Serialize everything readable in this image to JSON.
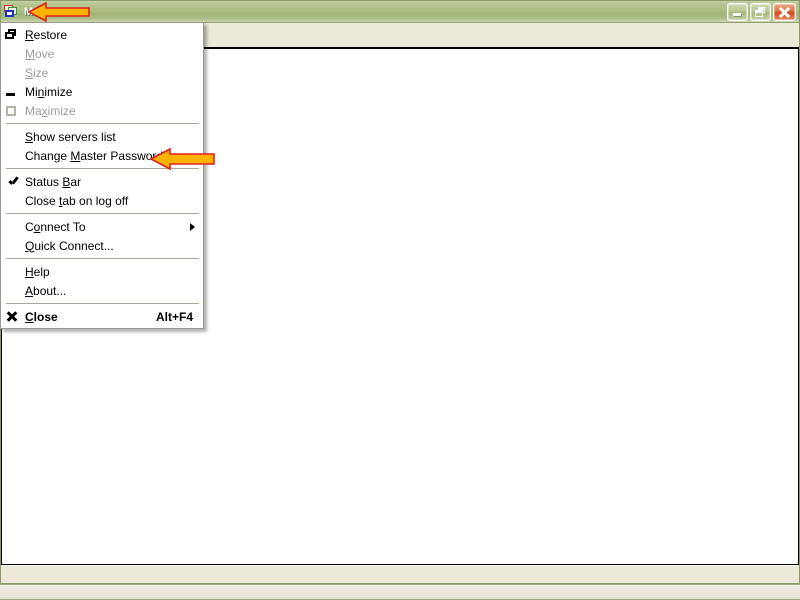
{
  "window": {
    "title": "M...k",
    "icon": "tabs-windows-icon",
    "caption_buttons": [
      {
        "name": "minimize-button",
        "label": "Minimize"
      },
      {
        "name": "restore-button",
        "label": "Restore"
      },
      {
        "name": "close-button",
        "label": "Close"
      }
    ]
  },
  "status_bar": {
    "text": ""
  },
  "system_menu": {
    "items": [
      {
        "type": "item",
        "name": "menu-item-restore",
        "icon": "restore-icon",
        "label": "Restore",
        "mnemonic": "R",
        "accel": "",
        "disabled": false,
        "bold": false,
        "submenu": false
      },
      {
        "type": "item",
        "name": "menu-item-move",
        "icon": "",
        "label": "Move",
        "mnemonic": "M",
        "accel": "",
        "disabled": true,
        "bold": false,
        "submenu": false
      },
      {
        "type": "item",
        "name": "menu-item-size",
        "icon": "",
        "label": "Size",
        "mnemonic": "S",
        "accel": "",
        "disabled": true,
        "bold": false,
        "submenu": false
      },
      {
        "type": "item",
        "name": "menu-item-minimize",
        "icon": "minimize-icon",
        "label": "Minimize",
        "mnemonic": "n",
        "accel": "",
        "disabled": false,
        "bold": false,
        "submenu": false
      },
      {
        "type": "item",
        "name": "menu-item-maximize",
        "icon": "maximize-icon",
        "label": "Maximize",
        "mnemonic": "x",
        "accel": "",
        "disabled": true,
        "bold": false,
        "submenu": false
      },
      {
        "type": "sep",
        "name": "menu-separator-1"
      },
      {
        "type": "item",
        "name": "menu-item-show-servers-list",
        "icon": "",
        "label": "Show servers list",
        "mnemonic": "S",
        "accel": "",
        "disabled": false,
        "bold": false,
        "submenu": false
      },
      {
        "type": "item",
        "name": "menu-item-change-master-password",
        "icon": "",
        "label": "Change Master Password",
        "mnemonic": "M",
        "accel": "",
        "disabled": false,
        "bold": false,
        "submenu": false
      },
      {
        "type": "sep",
        "name": "menu-separator-2"
      },
      {
        "type": "item",
        "name": "menu-item-status-bar",
        "icon": "check-icon",
        "label": "Status Bar",
        "mnemonic": "B",
        "accel": "",
        "disabled": false,
        "bold": false,
        "submenu": false
      },
      {
        "type": "item",
        "name": "menu-item-close-tab-on-logoff",
        "icon": "",
        "label": "Close tab on log off",
        "mnemonic": "t",
        "accel": "",
        "disabled": false,
        "bold": false,
        "submenu": false
      },
      {
        "type": "sep",
        "name": "menu-separator-3"
      },
      {
        "type": "item",
        "name": "menu-item-connect-to",
        "icon": "",
        "label": "Connect To",
        "mnemonic": "o",
        "accel": "",
        "disabled": false,
        "bold": false,
        "submenu": true
      },
      {
        "type": "item",
        "name": "menu-item-quick-connect",
        "icon": "",
        "label": "Quick Connect...",
        "mnemonic": "Q",
        "accel": "",
        "disabled": false,
        "bold": false,
        "submenu": false
      },
      {
        "type": "sep",
        "name": "menu-separator-4"
      },
      {
        "type": "item",
        "name": "menu-item-help",
        "icon": "",
        "label": "Help",
        "mnemonic": "H",
        "accel": "",
        "disabled": false,
        "bold": false,
        "submenu": false
      },
      {
        "type": "item",
        "name": "menu-item-about",
        "icon": "",
        "label": "About...",
        "mnemonic": "A",
        "accel": "",
        "disabled": false,
        "bold": false,
        "submenu": false
      },
      {
        "type": "sep",
        "name": "menu-separator-5"
      },
      {
        "type": "item",
        "name": "menu-item-close",
        "icon": "close-x-icon",
        "label": "Close",
        "mnemonic": "C",
        "accel": "Alt+F4",
        "disabled": false,
        "bold": true,
        "submenu": false
      }
    ]
  },
  "annotations": [
    {
      "name": "annotation-arrow-titlebar",
      "points_to": "window-title",
      "fill": "#FFB300",
      "stroke": "#E02020"
    },
    {
      "name": "annotation-arrow-change-master-password",
      "points_to": "menu-item-change-master-password",
      "fill": "#FFB300",
      "stroke": "#E02020"
    }
  ],
  "colors": {
    "titlebar_green": "#9fb477",
    "face": "#ece9d8",
    "menu_bg": "#ffffff",
    "disabled_text": "#9d9d9d",
    "arrow_fill": "#FFB300",
    "arrow_stroke": "#E02020"
  }
}
